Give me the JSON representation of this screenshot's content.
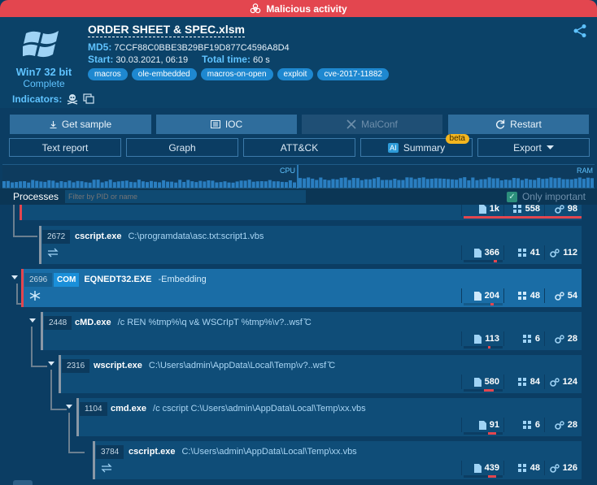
{
  "banner": {
    "label": "Malicious activity"
  },
  "os": {
    "name": "Win7 32 bit",
    "status": "Complete"
  },
  "file": {
    "title": "ORDER SHEET & SPEC.xlsm",
    "md5_label": "MD5:",
    "md5": "7CCF88C0BBE3B29BF19D877C4596A8D4",
    "start_label": "Start:",
    "start": "30.03.2021, 06:19",
    "total_label": "Total time:",
    "total": "60 s"
  },
  "tags": [
    "macros",
    "ole-embedded",
    "macros-on-open",
    "exploit",
    "cve-2017-11882"
  ],
  "indicators": {
    "label": "Indicators:"
  },
  "actions_row1": [
    "Get sample",
    "IOC",
    "MalConf",
    "Restart"
  ],
  "actions_row2": [
    "Text report",
    "Graph",
    "ATT&CK",
    "Summary",
    "Export"
  ],
  "summary_badge": "beta",
  "ai_badge": "AI",
  "graph": {
    "cpu_label": "CPU",
    "ram_label": "RAM"
  },
  "processes": {
    "title": "Processes",
    "filter_placeholder": "Filter by PID or name",
    "only_important": "Only important"
  },
  "rows": [
    {
      "pid": "",
      "name": "",
      "args": "",
      "stats": [
        "1k",
        "558",
        "98"
      ]
    },
    {
      "pid": "2672",
      "name": "cscript.exe",
      "args": "C:\\programdata\\asc.txt:script1.vbs",
      "stats": [
        "366",
        "41",
        "112"
      ]
    },
    {
      "pid": "2696",
      "badge": "COM",
      "name": "EQNEDT32.EXE",
      "args": "-Embedding",
      "stats": [
        "204",
        "48",
        "54"
      ]
    },
    {
      "pid": "2448",
      "name": "cMD.exe",
      "args": "/c REN %tmp%\\q v& WSCrIpT %tmp%\\v?..wsf ̌̌C",
      "stats": [
        "113",
        "6",
        "28"
      ]
    },
    {
      "pid": "2316",
      "name": "wscript.exe",
      "args": "C:\\Users\\admin\\AppData\\Local\\Temp\\v?..wsf ̌̌C",
      "stats": [
        "580",
        "84",
        "124"
      ]
    },
    {
      "pid": "1104",
      "name": "cmd.exe",
      "args": "/c cscript C:\\Users\\admin\\AppData\\Local\\Temp\\xx.vbs",
      "stats": [
        "91",
        "6",
        "28"
      ]
    },
    {
      "pid": "3784",
      "name": "cscript.exe",
      "args": "C:\\Users\\admin\\AppData\\Local\\Temp\\xx.vbs",
      "stats": [
        "439",
        "48",
        "126"
      ]
    }
  ],
  "colors": {
    "malicious": "#e3464f",
    "accent": "#5fc3ff",
    "background": "#0b3d63"
  }
}
